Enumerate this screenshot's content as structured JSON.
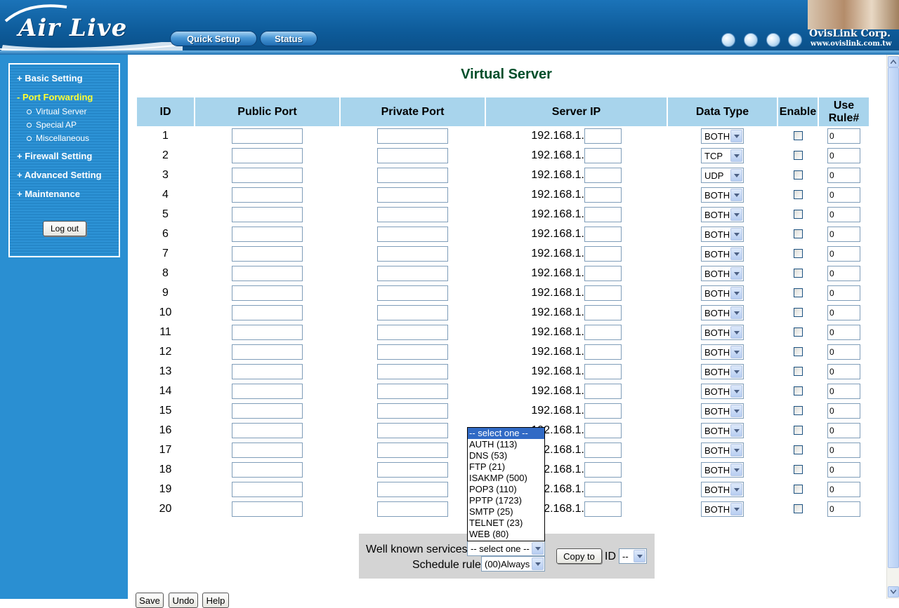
{
  "header": {
    "brand": "Air Live",
    "nav": [
      "Quick Setup",
      "Status"
    ],
    "corp_name": "OvisLink Corp.",
    "corp_url": "www.ovislink.com.tw"
  },
  "sidebar": {
    "items": [
      {
        "label": "+ Basic Setting",
        "active": false
      },
      {
        "label": "- Port Forwarding",
        "active": true
      },
      {
        "label": "+ Firewall Setting",
        "active": false
      },
      {
        "label": "+ Advanced Setting",
        "active": false
      },
      {
        "label": "+ Maintenance",
        "active": false
      }
    ],
    "subitems": [
      "Virtual Server",
      "Special AP",
      "Miscellaneous"
    ],
    "logout_label": "Log out"
  },
  "main": {
    "title": "Virtual Server",
    "columns": [
      "ID",
      "Public Port",
      "Private Port",
      "Server IP",
      "Data Type",
      "Enable",
      "Use Rule#"
    ],
    "ip_prefix": "192.168.1.",
    "rows": [
      {
        "id": "1",
        "type": "BOTH",
        "rule": "0"
      },
      {
        "id": "2",
        "type": "TCP",
        "rule": "0"
      },
      {
        "id": "3",
        "type": "UDP",
        "rule": "0"
      },
      {
        "id": "4",
        "type": "BOTH",
        "rule": "0"
      },
      {
        "id": "5",
        "type": "BOTH",
        "rule": "0"
      },
      {
        "id": "6",
        "type": "BOTH",
        "rule": "0"
      },
      {
        "id": "7",
        "type": "BOTH",
        "rule": "0"
      },
      {
        "id": "8",
        "type": "BOTH",
        "rule": "0"
      },
      {
        "id": "9",
        "type": "BOTH",
        "rule": "0"
      },
      {
        "id": "10",
        "type": "BOTH",
        "rule": "0"
      },
      {
        "id": "11",
        "type": "BOTH",
        "rule": "0"
      },
      {
        "id": "12",
        "type": "BOTH",
        "rule": "0"
      },
      {
        "id": "13",
        "type": "BOTH",
        "rule": "0"
      },
      {
        "id": "14",
        "type": "BOTH",
        "rule": "0"
      },
      {
        "id": "15",
        "type": "BOTH",
        "rule": "0"
      },
      {
        "id": "16",
        "type": "BOTH",
        "rule": "0"
      },
      {
        "id": "17",
        "type": "BOTH",
        "rule": "0"
      },
      {
        "id": "18",
        "type": "BOTH",
        "rule": "0"
      },
      {
        "id": "19",
        "type": "BOTH",
        "rule": "0"
      },
      {
        "id": "20",
        "type": "BOTH",
        "rule": "0"
      }
    ],
    "well_known": {
      "label": "Well known services",
      "selected": "-- select one --",
      "options": [
        "-- select one --",
        "AUTH (113)",
        "DNS (53)",
        "FTP (21)",
        "ISAKMP (500)",
        "POP3 (110)",
        "PPTP (1723)",
        "SMTP (25)",
        "TELNET (23)",
        "WEB (80)"
      ]
    },
    "schedule": {
      "label": "Schedule rule",
      "selected": "(00)Always"
    },
    "copy_label": "Copy to",
    "id_label": "ID",
    "id_selected": "--",
    "footer_buttons": [
      "Save",
      "Undo",
      "Help"
    ]
  },
  "colors": {
    "header_blue": "#0d5a98",
    "sidebar_blue": "#2a8fd2",
    "table_header": "#a8d4ec",
    "title_green": "#004e2a",
    "active_menu": "#ffff33"
  }
}
